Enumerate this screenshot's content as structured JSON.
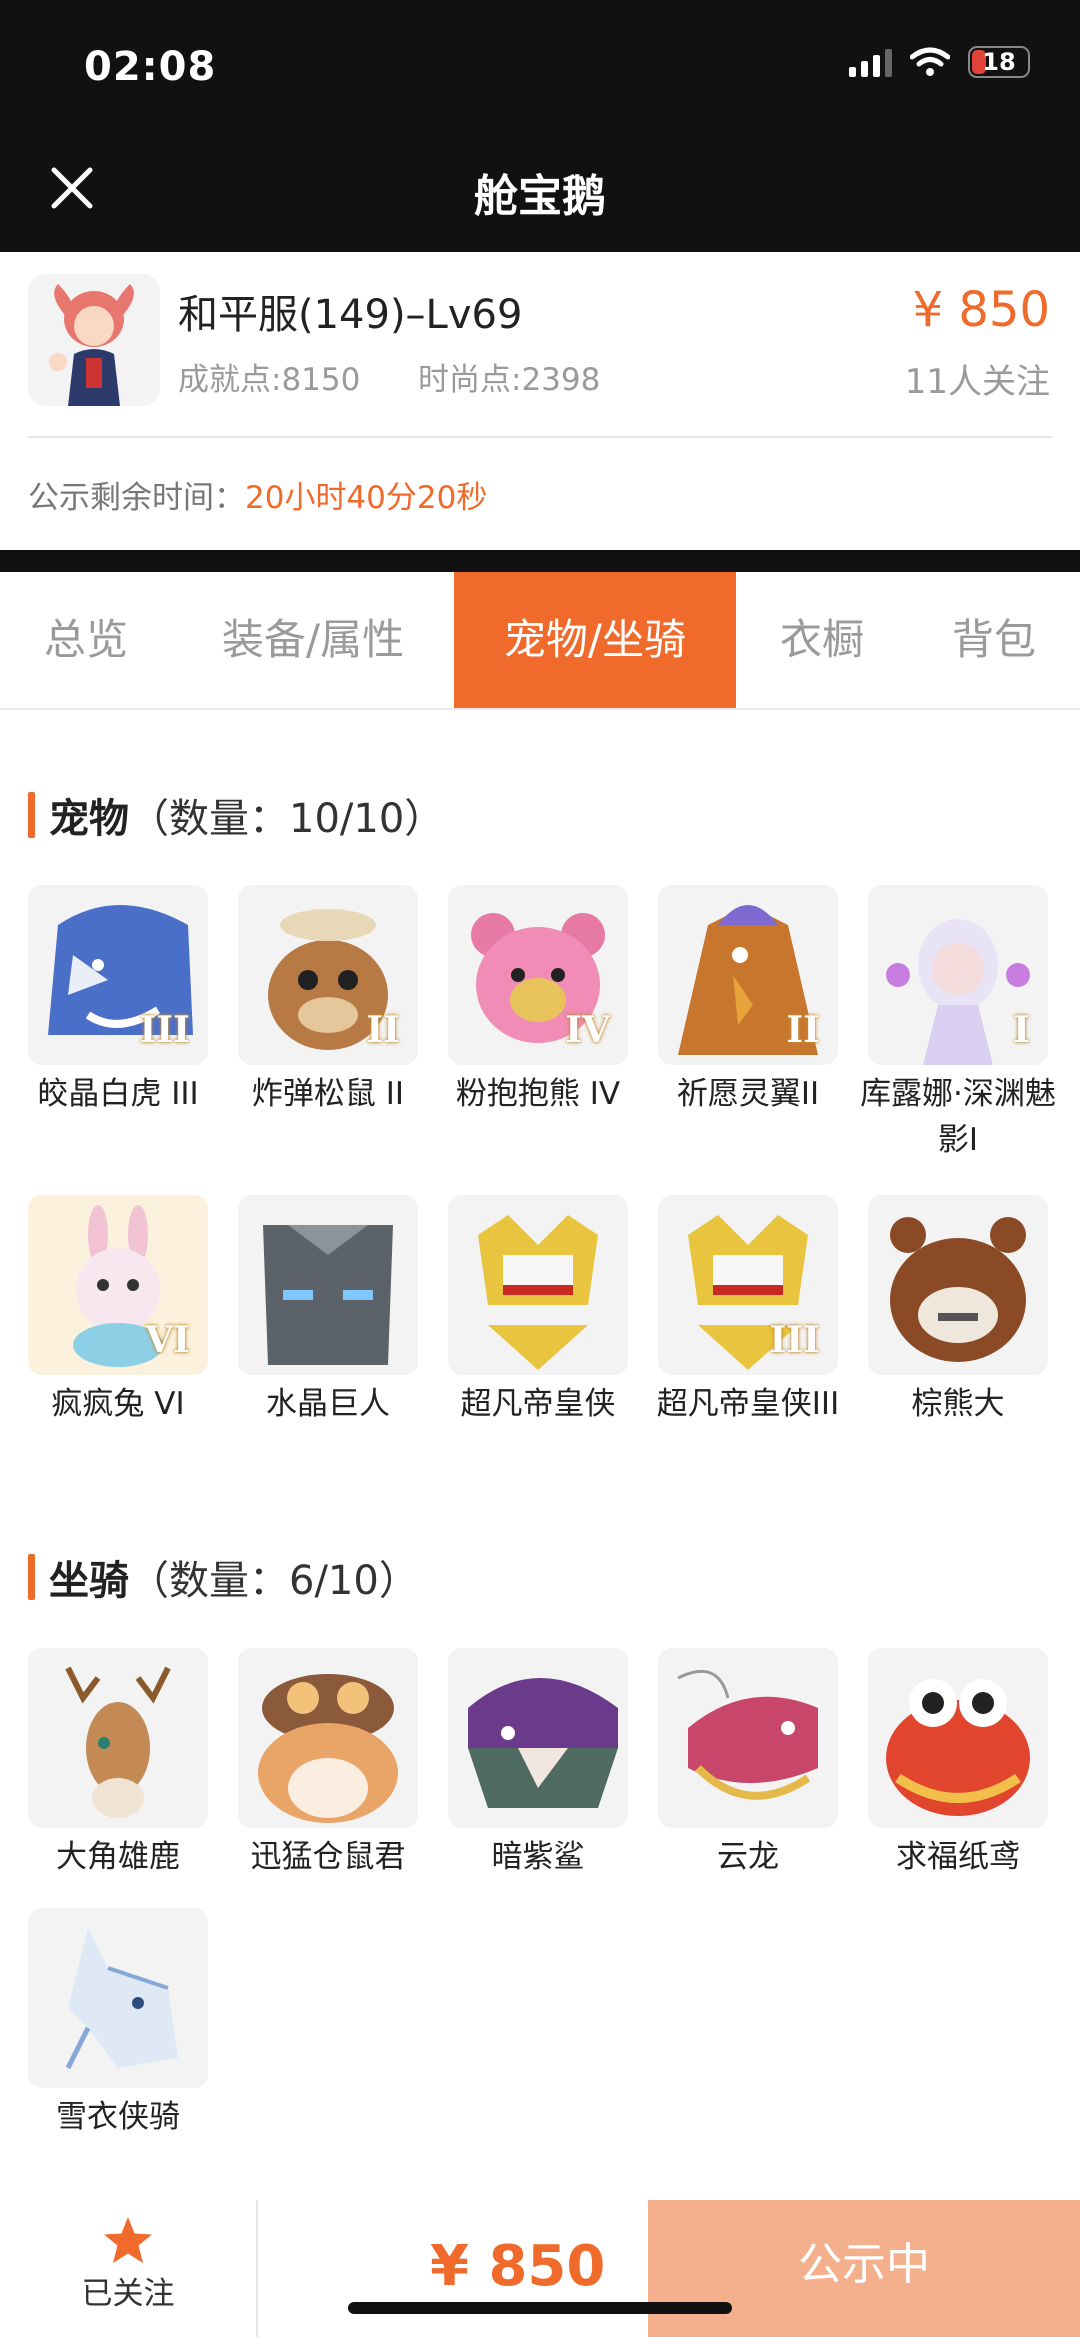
{
  "status_bar": {
    "time": "02:08",
    "battery": "18"
  },
  "nav": {
    "title": "舱宝鹅"
  },
  "header": {
    "character": "和平服(149)–Lv69",
    "achievement": "成就点:8150",
    "fashion": "时尚点:2398",
    "price": "¥ 850",
    "followers": "11人关注",
    "countdown_label": "公示剩余时间：",
    "countdown_value": "20小时40分20秒"
  },
  "tabs": [
    "总览",
    "装备/属性",
    "宠物/坐骑",
    "衣橱",
    "背包"
  ],
  "active_tab": "宠物/坐骑",
  "pets": {
    "title": "宠物",
    "count": "（数量：10/10）",
    "items": [
      {
        "name": "皎晶白虎 III",
        "badge": "III"
      },
      {
        "name": "炸弹松鼠 II",
        "badge": "II"
      },
      {
        "name": "粉抱抱熊 IV",
        "badge": "IV"
      },
      {
        "name": "祈愿灵翼II",
        "badge": "II"
      },
      {
        "name": "库露娜·深渊魅影I",
        "badge": "I"
      },
      {
        "name": "疯疯兔 VI",
        "badge": "VI"
      },
      {
        "name": "水晶巨人",
        "badge": ""
      },
      {
        "name": "超凡帝皇侠",
        "badge": ""
      },
      {
        "name": "超凡帝皇侠III",
        "badge": "III"
      },
      {
        "name": "棕熊大",
        "badge": ""
      }
    ]
  },
  "mounts": {
    "title": "坐骑",
    "count": "（数量：6/10）",
    "items": [
      {
        "name": "大角雄鹿"
      },
      {
        "name": "迅猛仓鼠君"
      },
      {
        "name": "暗紫鲨"
      },
      {
        "name": "云龙"
      },
      {
        "name": "求福纸鸢"
      },
      {
        "name": "雪衣侠骑"
      }
    ]
  },
  "bottom": {
    "follow_label": "已关注",
    "price": "¥ 850",
    "status": "公示中"
  },
  "colors": {
    "accent": "#ef6a2b",
    "status_button": "#f4b08c"
  }
}
